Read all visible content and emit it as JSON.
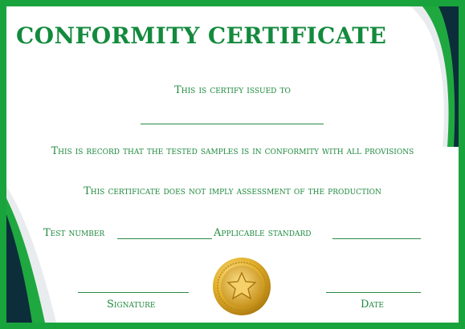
{
  "certificate": {
    "title": "CONFORMITY CERTIFICATE",
    "issued_to_label": "This is certify issued to",
    "record_statement": "This is record that the tested samples is in conformity with all provisions",
    "disclaimer": "This certificate does not imply assessment of the production",
    "test_number_label": "Test number",
    "applicable_standard_label": "Applicable standard",
    "signature_label": "Signature",
    "date_label": "Date"
  },
  "colors": {
    "border": "#19a33c",
    "text_green": "#138a3d",
    "dark_navy": "#0b2e3a",
    "bright_green": "#1fa83f",
    "gold": "#d4a21d"
  },
  "icons": {
    "seal": "gold-star-medal-icon"
  }
}
